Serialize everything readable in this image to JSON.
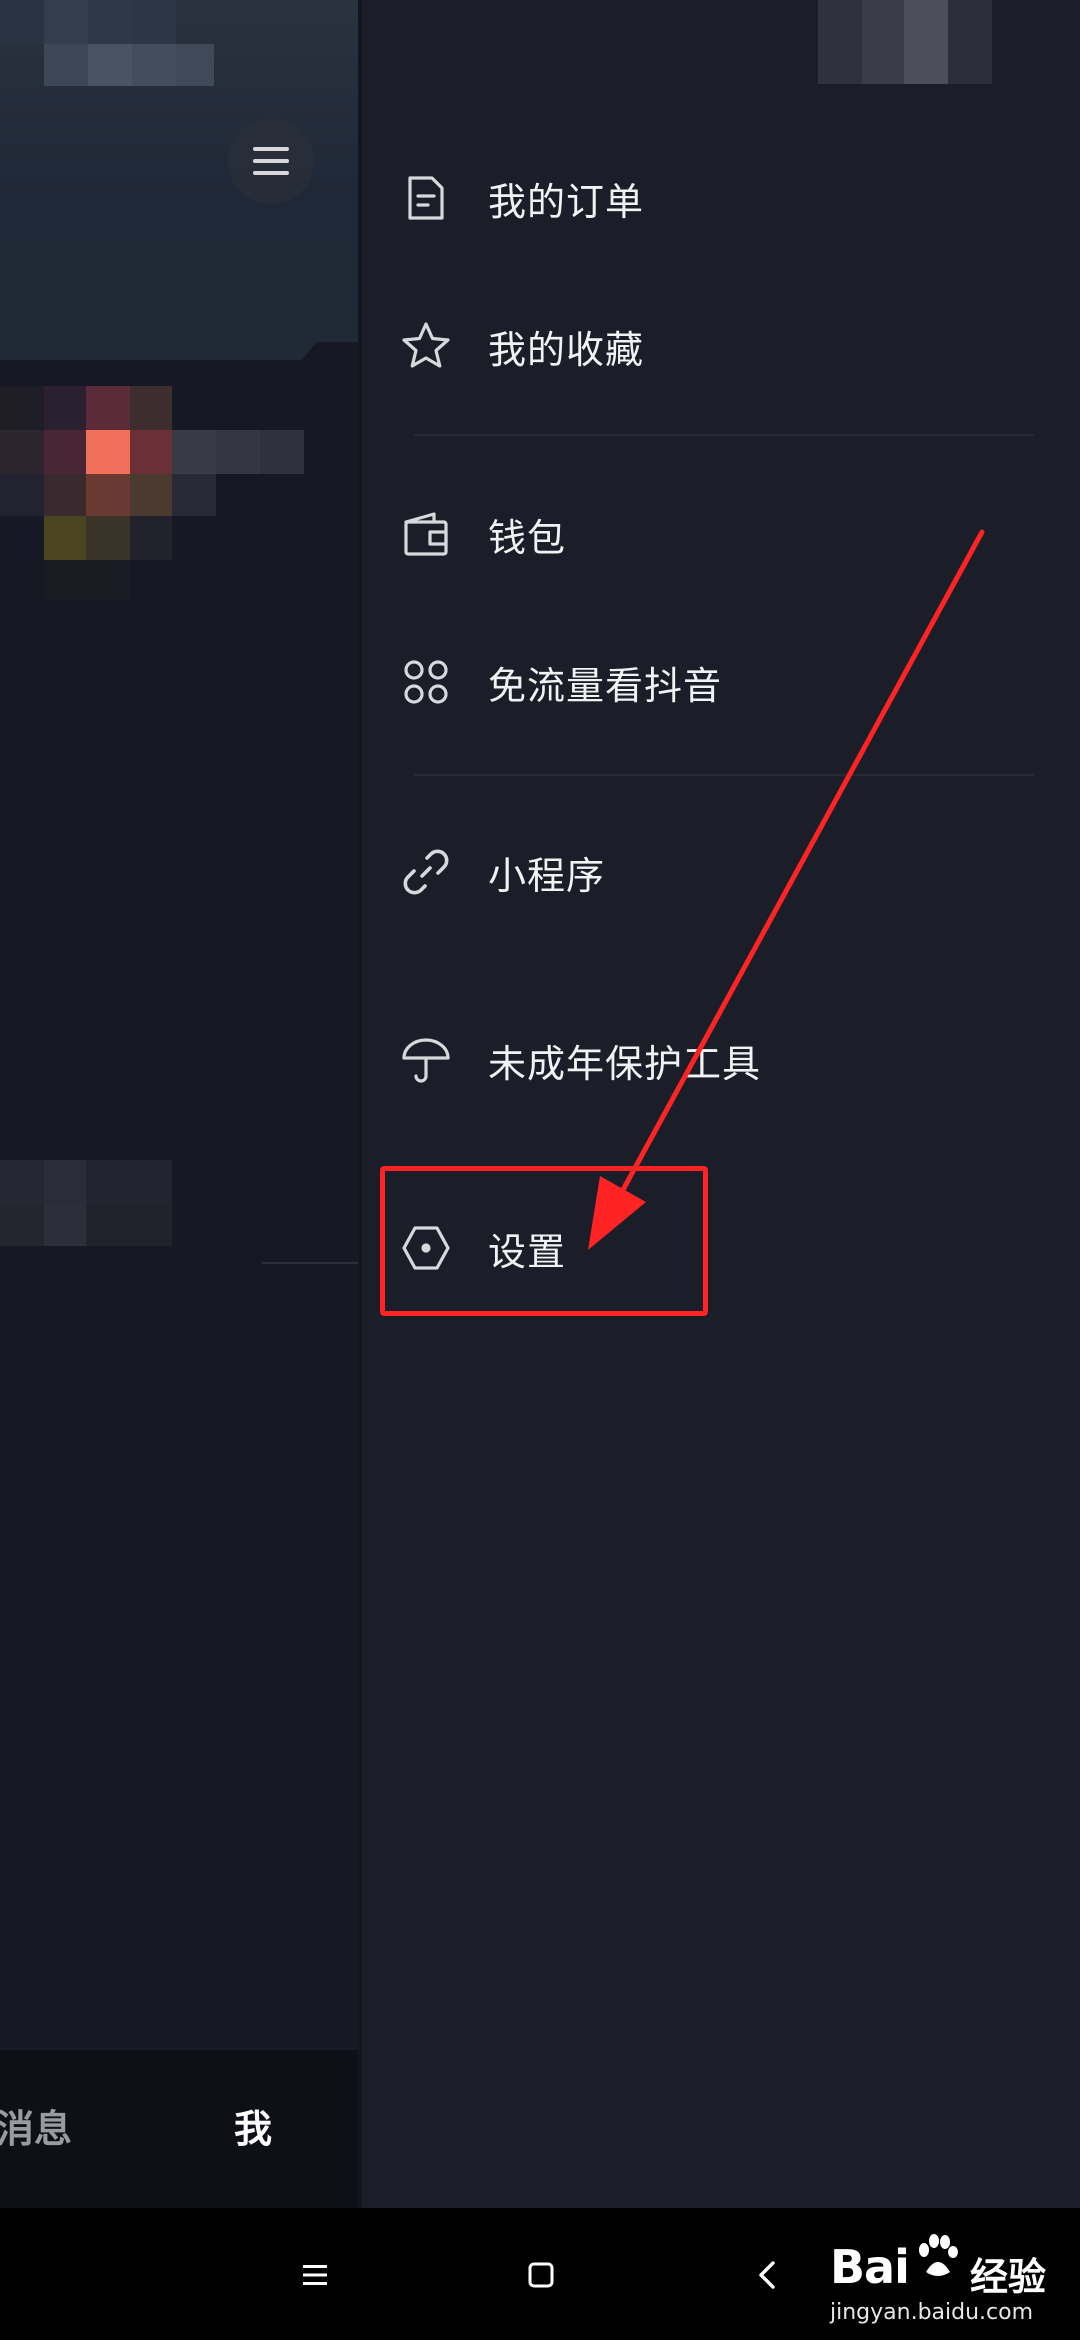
{
  "drawer": {
    "items": [
      {
        "label": "我的订单",
        "icon": "document-icon"
      },
      {
        "label": "我的收藏",
        "icon": "star-icon"
      },
      {
        "label": "钱包",
        "icon": "wallet-icon"
      },
      {
        "label": "免流量看抖音",
        "icon": "grid-apps-icon"
      },
      {
        "label": "小程序",
        "icon": "link-icon"
      },
      {
        "label": "未成年保护工具",
        "icon": "umbrella-icon"
      },
      {
        "label": "设置",
        "icon": "settings-hexagon-icon"
      }
    ]
  },
  "tabbar": {
    "messages_label": "消息",
    "me_label": "我"
  },
  "annotation": {
    "box_color": "#ff2323",
    "arrow_color": "#ff2323",
    "highlighted_item": "设置"
  },
  "watermark": {
    "logo_text": "Bai",
    "logo_suffix": "经验",
    "url": "jingyan.baidu.com"
  },
  "colors": {
    "background": "#161823",
    "drawer": "#1b1e28",
    "text": "#f2f2f4"
  }
}
